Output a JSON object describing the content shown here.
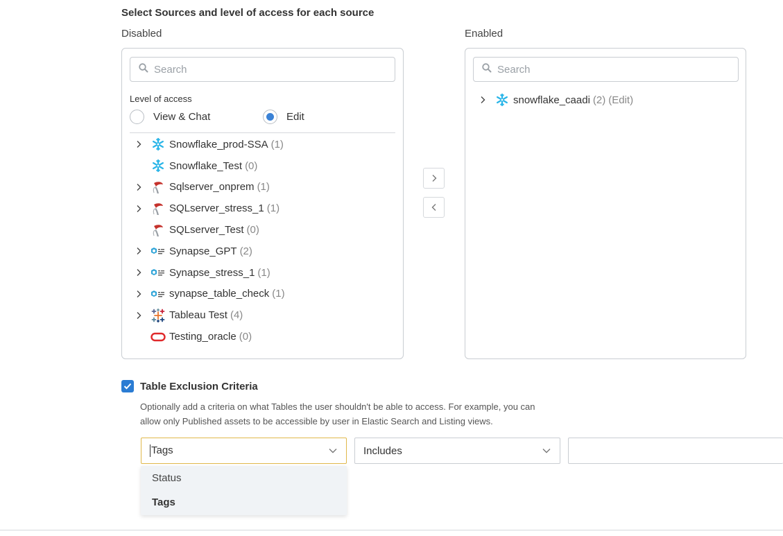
{
  "section_title": "Select Sources and level of access for each source",
  "disabled_label": "Disabled",
  "enabled_label": "Enabled",
  "left_search_placeholder": "Search",
  "right_search_placeholder": "Search",
  "level_of_access": {
    "label": "Level of access",
    "options": [
      {
        "label": "View & Chat",
        "checked": false
      },
      {
        "label": "Edit",
        "checked": true
      }
    ]
  },
  "disabled_sources": [
    {
      "name": "Snowflake_prod-SSA",
      "count": "(1)",
      "icon": "snowflake-icon",
      "expandable": true
    },
    {
      "name": "Snowflake_Test",
      "count": "(0)",
      "icon": "snowflake-icon",
      "expandable": false
    },
    {
      "name": "Sqlserver_onprem",
      "count": "(1)",
      "icon": "sqlserver-icon",
      "expandable": true
    },
    {
      "name": "SQLserver_stress_1",
      "count": "(1)",
      "icon": "sqlserver-icon",
      "expandable": true
    },
    {
      "name": "SQLserver_Test",
      "count": "(0)",
      "icon": "sqlserver-icon",
      "expandable": false
    },
    {
      "name": "Synapse_GPT",
      "count": "(2)",
      "icon": "synapse-icon",
      "expandable": true
    },
    {
      "name": "Synapse_stress_1",
      "count": "(1)",
      "icon": "synapse-icon",
      "expandable": true
    },
    {
      "name": "synapse_table_check",
      "count": "(1)",
      "icon": "synapse-icon",
      "expandable": true
    },
    {
      "name": "Tableau Test",
      "count": "(4)",
      "icon": "tableau-icon",
      "expandable": true
    },
    {
      "name": "Testing_oracle",
      "count": "(0)",
      "icon": "oracle-icon",
      "expandable": false
    }
  ],
  "enabled_sources": [
    {
      "name": "snowflake_caadi",
      "count": "(2)",
      "access": "(Edit)",
      "icon": "snowflake-icon",
      "expandable": true
    }
  ],
  "exclusion": {
    "checked": true,
    "title": "Table Exclusion Criteria",
    "desc_line1": "Optionally add a criteria on what Tables the user shouldn't be able to access. For example, you can",
    "desc_line2": "allow only Published assets to be accessible by user in Elastic Search and Listing views.",
    "field_value": "Tags",
    "operator_value": "Includes",
    "value_input": "",
    "field_options": [
      {
        "label": "Status",
        "selected": false
      },
      {
        "label": "Tags",
        "selected": true
      }
    ]
  },
  "colors": {
    "accent": "#2b7cd3",
    "radio_dot": "#3b82d6",
    "focus_border": "#e0b84a",
    "snowflake": "#29b5e8",
    "oracle": "#e0292b"
  }
}
